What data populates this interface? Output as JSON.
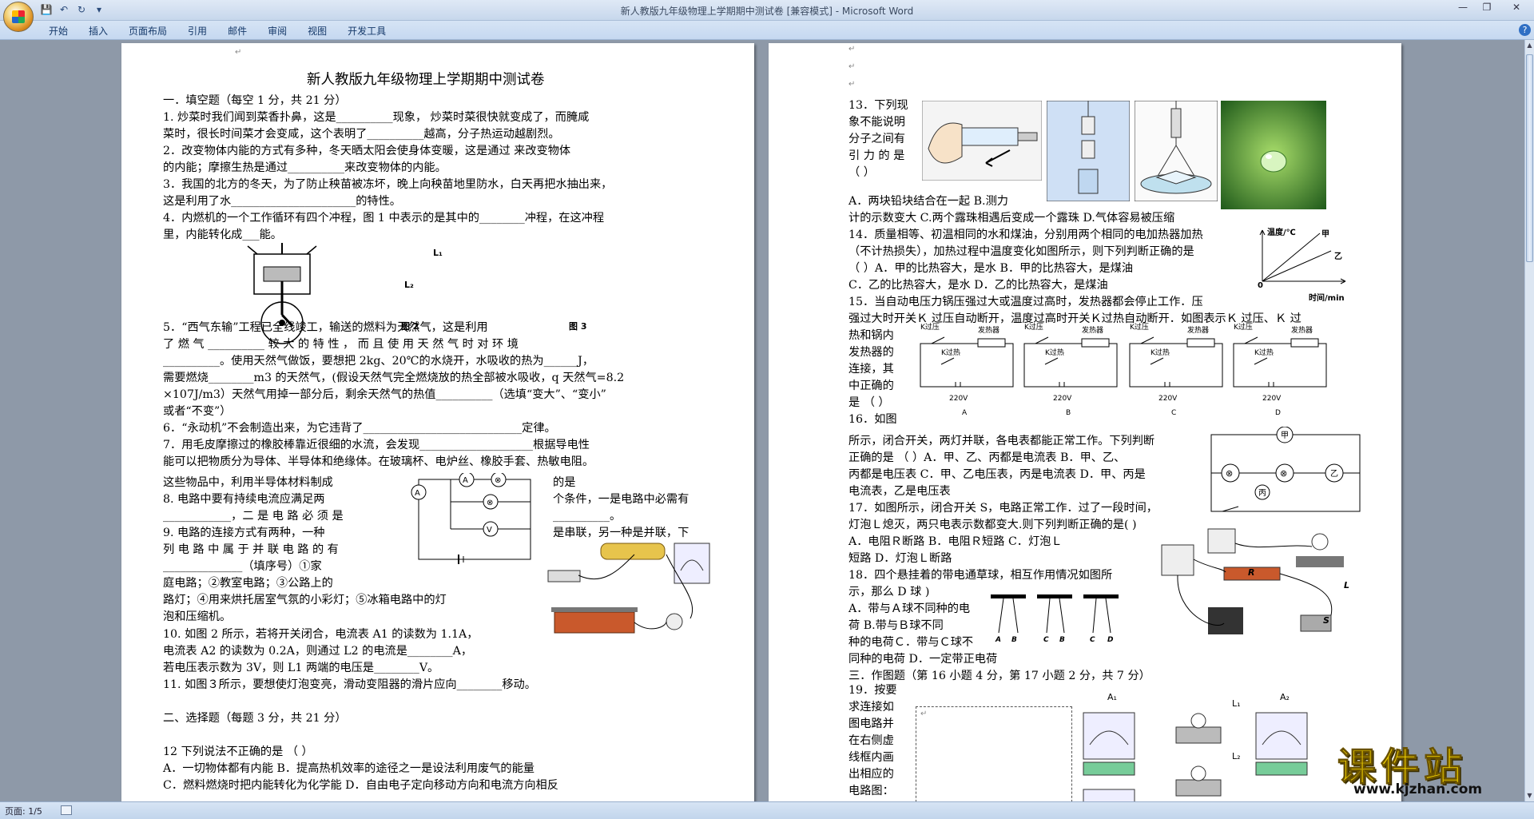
{
  "window": {
    "title": "新人教版九年级物理上学期期中测试卷 [兼容模式] - Microsoft Word"
  },
  "ribbon": {
    "tabs": [
      "开始",
      "插入",
      "页面布局",
      "引用",
      "邮件",
      "审阅",
      "视图",
      "开发工具"
    ]
  },
  "status": {
    "page": "页面: 1/5"
  },
  "logo": {
    "main": "课件站",
    "url": "www.kjzhan.com"
  },
  "page1": {
    "title": "新人教版九年级物理上学期期中测试卷",
    "lines": [
      "一．填空题（每空 1 分，共 21 分）",
      "1. 炒菜时我们闻到菜香扑鼻，这是__________现象，  炒菜时菜很快就变成了，而腌咸",
      "菜时，很长时间菜才会变咸，这个表明了__________越高，分子热运动越剧烈。",
      "2．改变物体内能的方式有多种，冬天晒太阳会使身体变暖，这是通过      来改变物体",
      "的内能；摩擦生热是通过__________来改变物体的内能。",
      "3．我国的北方的冬天，为了防止秧苗被冻坏，晚上向秧苗地里防水，白天再把水抽出来，",
      "这是利用了水______________________的特性。",
      "4．内燃机的一个工作循环有四个冲程，图 1 中表示的是其中的________冲程，在这冲程",
      "里，内能转化成___能。"
    ],
    "lines2": [
      "5．“西气东输”工程已全线竣工，输送的燃料为天然气，这是利用",
      "了 燃          气 __________ 较 大 的 特 性 ， 而 且 使 用 天 然 气 时 对 环 境",
      "__________。使用天然气做饭，要想把 2kg、20℃的水烧开，水吸收的热为______J，",
      "需要燃烧________m3 的天然气，(假设天然气完全燃烧放的热全部被水吸收，q 天然气=8.2",
      "×107J/m3）天然气用掉一部分后，剩余天然气的热值__________（选填“变大”、“变小”",
      "或者“不变”）",
      "6．“永动机”不会制造出来，为它违背了____________________________定律。",
      "7．用毛皮摩擦过的橡胶棒靠近很细的水流，会发现____________________根据导电性",
      "能可以把物质分为导体、半导体和绝缘体。在玻璃杯、电炉丝、橡胶手套、热敏电阻。"
    ],
    "left_col": [
      "这些物品中，利用半导体材料制成",
      "8. 电路中要有持续电流应满足两",
      "____________，二 是 电 路 必 须 是",
      "9. 电路的连接方式有两种，一种",
      "列 电 路 中 属 于 并 联 电 路 的 有",
      "______________（填序号）①家",
      "庭电路；②教室电路；③公路上的",
      "路灯；④用来烘托居室气氛的小彩灯；⑤冰箱电路中的灯",
      "泡和压缩机。"
    ],
    "right_col": [
      "的是          ",
      "个条件，一是电路中必需有",
      "__________。",
      "是串联，另一种是并联，下"
    ],
    "lines3": [
      "10. 如图 2 所示，若将开关闭合，电流表 A1 的读数为 1.1A，",
      "电流表 A2 的读数为 0.2A，则通过 L2 的电流是________A，",
      "若电压表示数为 3V，则 L1 两端的电压是________V。",
      "11. 如图３所示，要想使灯泡变亮，滑动变阻器的滑片应向________移动。",
      "",
      "二、选择题（每题 3 分，共 21 分）",
      "",
      "12 下列说法不正确的是  （      ）",
      "A．一切物体都有内能 B．提高热机效率的途径之一是设法利用废气的能量",
      "C．燃料燃烧时把内能转化为化学能         D．自由电子定向移动方向和电流方向相反"
    ],
    "labels": {
      "l1": "L₁",
      "l2": "L₂",
      "fig2": "图 2",
      "fig3": "图 3"
    }
  },
  "page2": {
    "q13": [
      "13．下列现",
      "象不能说明",
      "分子之间有",
      "引 力 的 是",
      "（    ）"
    ],
    "lines": [
      "A．两块铅块结合在一起   B.测力",
      "计的示数变大  C.两个露珠相遇后变成一个露珠 D.气体容易被压缩",
      "14．质量相等、初温相同的水和煤油，分别用两个相同的电加热器加热",
      "（不计热损失），加热过程中温度变化如图所示，则下列判断正确的是",
      "（      ）A．甲的比热容大，是水        B．甲的比热容大，是煤油",
      "C．乙的比热容大，是水          D．乙的比热容大，是煤油",
      "15．当自动电压力锅压强过大或温度过高时，发热器都会停止工作．压",
      "强过大时开关Ｋ 过压自动断开，温度过高时开关Ｋ过热自动断开．如图表示Ｋ 过压、Ｋ 过"
    ],
    "q15_left": [
      "热和锅内",
      "发热器的",
      "连接，其",
      "中正确的",
      "是 （   ）",
      "16．如图"
    ],
    "q16": [
      "所示，闭合开关，两灯并联，各电表都能正常工作。下列判断",
      "正确的是    （      ）A．甲、乙、丙都是电流表   B．甲、乙、",
      "丙都是电压表 C．甲、乙电压表，丙是电流表 D．甲、丙是",
      "电流表，乙是电压表",
      "17．如图所示，闭合开关 S，电路正常工作．过了一段时间，",
      "灯泡Ｌ熄灭，两只电表示数都变大.则下列判断正确的是(      )",
      "A．电阻Ｒ断路        B．电阻Ｒ短路        C．灯泡Ｌ",
      "短路        D．灯泡Ｌ断路",
      "18．四个悬挂着的带电通草球，相互作用情况如图所",
      "示，那么 D 球      )",
      "A．带与Ａ球不同种的电",
      "荷        B.带与Ｂ球不同",
      "种的电荷Ｃ．带与Ｃ球不",
      "同种的电荷 D．一定带正电荷",
      "三．作图题（第 16 小题 4 分，第 17 小题 2 分，共 7 分）"
    ],
    "q19": [
      "19．按要",
      "求连接如",
      "图电路并",
      "在右侧虚",
      "线框内画",
      "出相应的",
      "电路图："
    ],
    "chart": {
      "ylabel": "温度/℃",
      "xlabel": "时间/min",
      "series_a": "甲",
      "series_b": "乙",
      "origin": "0"
    },
    "circuit": {
      "k_over_pressure": "K过压",
      "k_over_heat": "K过热",
      "heater": "发热器",
      "voltage": "220V",
      "options": [
        "A",
        "B",
        "C",
        "D"
      ]
    },
    "balls": [
      "A",
      "B",
      "C",
      "B",
      "C",
      "D"
    ],
    "meters": {
      "a1": "A₁",
      "a2": "A₂",
      "l1": "L₁",
      "l2": "L₂",
      "r": "R",
      "l": "L",
      "s": "S"
    }
  }
}
